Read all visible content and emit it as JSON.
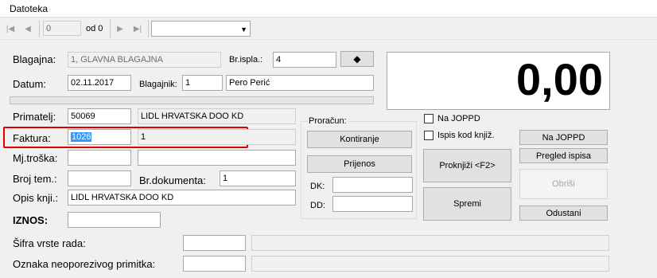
{
  "menubar": {
    "datoteka_label": "Datoteka"
  },
  "nav": {
    "record_value": "0",
    "count_label": "od 0",
    "combo_value": ""
  },
  "header": {
    "blagajna_label": "Blagajna:",
    "blagajna_value": "1, GLAVNA BLAGAJNA",
    "br_ispla_label": "Br.ispla.:",
    "br_ispla_value": "4",
    "datum_label": "Datum:",
    "datum_value": "02.11.2017",
    "blagajnik_label": "Blagajnik:",
    "blagajnik_id": "1",
    "blagajnik_name": "Pero Perić"
  },
  "amount_display": "0,00",
  "form": {
    "primatelj_label": "Primatelj:",
    "primatelj_id": "50069",
    "primatelj_name": "LIDL HRVATSKA DOO KD",
    "faktura_label": "Faktura:",
    "faktura_value": "1026",
    "faktura_extra": "1",
    "mjtroska_label": "Mj.troška:",
    "brojtem_label": "Broj tem.:",
    "brdok_label": "Br.dokumenta:",
    "brdok_value": "1",
    "opis_label": "Opis knji.:",
    "opis_value": "LIDL HRVATSKA DOO KD",
    "iznos_label": "IZNOS:",
    "sifra_label": "Šifra vrste rada:",
    "oznaka_label": "Oznaka neoporezivog primitka:"
  },
  "proracun": {
    "title": "Proračun:",
    "kontiranje_label": "Kontiranje",
    "prijenos_label": "Prijenos",
    "dk_label": "DK:",
    "dd_label": "DD:"
  },
  "checks": {
    "na_joppd_label": "Na JOPPD",
    "ispis_label": "Ispis kod knjiž."
  },
  "buttons": {
    "proknjizi": "Proknjiži <F2>",
    "spremi": "Spremi",
    "na_joppd": "Na JOPPD",
    "pregled_ispisa": "Pregled ispisa",
    "obrisi": "Obriši",
    "odustani": "Odustani"
  },
  "colors": {
    "selection": "#3399ff",
    "highlight": "#e00000"
  }
}
